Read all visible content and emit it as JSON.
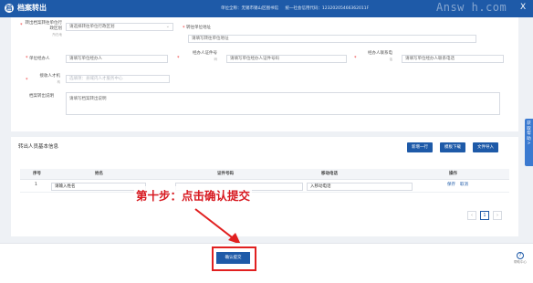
{
  "titlebar": {
    "logo": "档",
    "title": "档案转出",
    "unit_name": "单位全称：无锡市锡山区图书馆",
    "credit_code": "统一社会信用代码：12320205466362011F",
    "watermark": "Answ h.com",
    "close": "X"
  },
  "form": {
    "row1_label": "转出档案转往单位行政区划",
    "row1_sub": "所在地",
    "row1_placeholder": "请选择转往单位行政区划",
    "row1_caret": "⌄",
    "addr_label": "转往单位地址",
    "addr_placeholder": "请填写转往单位地址",
    "handler_label": "单位经办人",
    "handler_placeholder": "请填写单位经办人",
    "idno_label": "经办人证件号",
    "idno_sub": "码",
    "idno_placeholder": "请填写单位经办人证件号码",
    "phone_label": "经办人联系电",
    "phone_sub": "话",
    "phone_placeholder": "请填写单位经办人联系电话",
    "talent_label": "接收人才机",
    "talent_sub": "构",
    "talent_placeholder": "选填项：县域内人才服务中心",
    "note_label": "档案转出说明",
    "note_placeholder": "请填写档案转出说明"
  },
  "people": {
    "section_title": "转出人员基本信息",
    "buttons": {
      "add": "新增一行",
      "download": "模板下载",
      "import": "文件导入"
    },
    "columns": [
      "序号",
      "姓名",
      "证件号码",
      "移动电话",
      "操作"
    ],
    "rows": [
      {
        "index": "1",
        "name": "请输入姓名",
        "phone": "入移动电话",
        "save": "保存",
        "cancel": "取消"
      }
    ],
    "pager": {
      "prev": "‹",
      "page": "1",
      "next": "›"
    }
  },
  "annotation": "第十步：点击确认提交",
  "submit": "确认提交",
  "help": {
    "icon": "?",
    "label": "帮助中心"
  },
  "sidetab": "获\n取\n帮\n助\n>"
}
